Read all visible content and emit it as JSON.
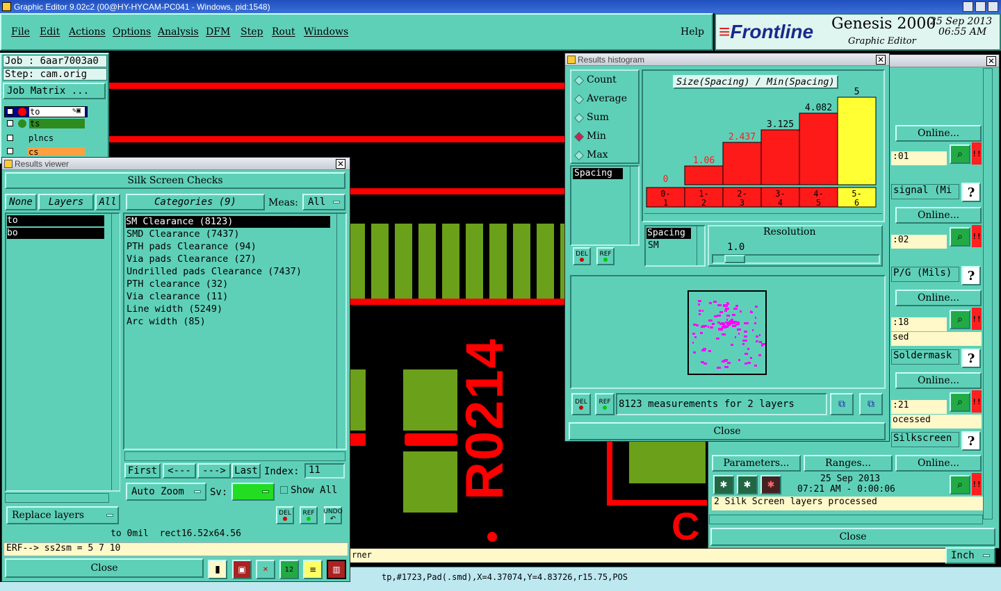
{
  "window_title": "Graphic Editor 9.02c2 (00@HY-HYCAM-PC041 - Windows, pid:1548)",
  "menu": [
    "File",
    "Edit",
    "Actions",
    "Options",
    "Analysis",
    "DFM",
    "Step",
    "Rout",
    "Windows"
  ],
  "help_label": "Help",
  "brand": {
    "logo": "Frontline",
    "product": "Genesis 2000",
    "subtitle": "Graphic Editor",
    "date": "25 Sep 2013",
    "time": "06:55 AM"
  },
  "job": {
    "job_label": "Job : 6aar7003a0",
    "step_label": "Step: cam.orig",
    "matrix_button": "Job Matrix ..."
  },
  "layers": [
    {
      "name": "to",
      "color": "#ff0000"
    },
    {
      "name": "ts",
      "color": "#2e8b20"
    },
    {
      "name": "plncs",
      "color": "#000000"
    },
    {
      "name": "cs",
      "color": "#ffa040"
    }
  ],
  "board_text": "R0214",
  "results_viewer": {
    "title": "Results viewer",
    "header": "Silk Screen Checks",
    "none_label": "None",
    "layers_label": "Layers",
    "all_label": "All",
    "categories_label": "Categories (9)",
    "meas_label": "Meas:",
    "meas_value": "All",
    "layer_list": [
      "to",
      "bo"
    ],
    "categories": [
      "SM Clearance (8123)",
      "SMD Clearance (7437)",
      "PTH pads Clearance (94)",
      "Via pads Clearance (27)",
      "Undrilled pads Clearance (7437)",
      "PTH clearance (32)",
      "Via clearance (11)",
      "Line width (5249)",
      "Arc width (85)"
    ],
    "nav": {
      "first": "First",
      "prev": "<---",
      "next": "--->",
      "last": "Last",
      "index_label": "Index:",
      "index_value": "11"
    },
    "auto_zoom": "Auto Zoom",
    "sv_label": "Sv:",
    "show_all": "Show All",
    "replace_layers": "Replace layers",
    "status_line": "to 0mil  rect16.52x64.56",
    "erf_line": "ERF--> ss2sm = 5 7 10",
    "close": "Close",
    "del": "DEL",
    "ref": "REF",
    "undo": "UNDO"
  },
  "histogram": {
    "title": "Results histogram",
    "modes": [
      "Count",
      "Average",
      "Sum",
      "Min",
      "Max"
    ],
    "selected_mode": "Min",
    "chart_title": "Size(Spacing) / Min(Spacing)",
    "list_item": "Spacing",
    "spacing_label": "Spacing",
    "sm_label": "SM",
    "resolution_label": "Resolution",
    "resolution_value": "1.0",
    "measurements": "8123 measurements for 2 layers",
    "close": "Close",
    "del": "DEL",
    "ref": "REF"
  },
  "chart_data": {
    "type": "bar",
    "title": "Size(Spacing) / Min(Spacing)",
    "categories": [
      "0-1",
      "1-2",
      "2-3",
      "3-4",
      "4-5",
      "5-6"
    ],
    "values": [
      0,
      1.06,
      2.437,
      3.125,
      4.082,
      5
    ],
    "value_labels": [
      "0",
      "1.06",
      "2.437",
      "3.125",
      "4.082",
      "5"
    ],
    "cat_top": [
      "0-",
      "1-",
      "2-",
      "3-",
      "4-",
      "5-"
    ],
    "cat_bottom": [
      "1",
      "2",
      "3",
      "4",
      "5",
      "6"
    ],
    "highlight_index": 5,
    "colors": {
      "bar": "#ff1a1a",
      "highlight": "#ffff33"
    }
  },
  "right_panel": {
    "rows": [
      {
        "online": "Online...",
        "time": ":01",
        "label": "signal (Mi"
      },
      {
        "online": "Online...",
        "time": ":02",
        "label": "P/G (Mils)"
      },
      {
        "online": "Online...",
        "time": ":18",
        "status": "sed",
        "label": "Soldermask"
      },
      {
        "online": "Online...",
        "time": ":21",
        "status": "ocessed",
        "label": "Silkscreen"
      }
    ],
    "params": "Parameters...",
    "ranges": "Ranges...",
    "online_last": "Online...",
    "last_date": "25 Sep 2013",
    "last_time": "07:21 AM - 0:00:06",
    "last_status": "2 Silk Screen layers processed",
    "close": "Close",
    "question": "?",
    "bang": "!!"
  },
  "bottom": {
    "corner_text": "rner",
    "units": "Inch",
    "status": "tp,#1723,Pad(.smd),X=4.37074,Y=4.83726,r15.75,POS"
  }
}
